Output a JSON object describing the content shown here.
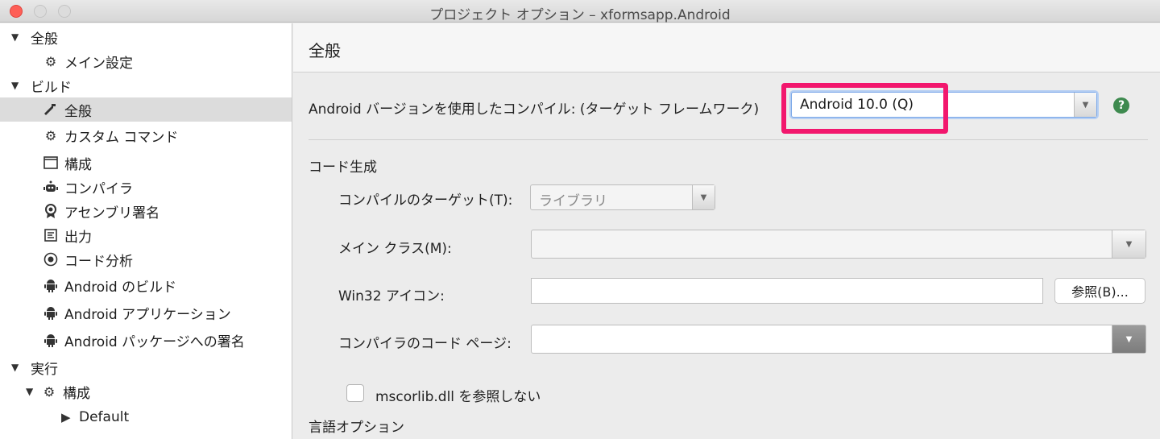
{
  "window": {
    "title": "プロジェクト オプション – xformsapp.Android"
  },
  "sidebar": {
    "items": [
      {
        "label": "全般",
        "icon": "triangle-down"
      },
      {
        "label": "メイン設定",
        "icon": "gear-icon"
      },
      {
        "label": "ビルド",
        "icon": "triangle-down"
      },
      {
        "label": "全般",
        "icon": "hammer-icon",
        "selected": true
      },
      {
        "label": "カスタム コマンド",
        "icon": "gear-icon"
      },
      {
        "label": "構成",
        "icon": "window-icon"
      },
      {
        "label": "コンパイラ",
        "icon": "robot-icon"
      },
      {
        "label": "アセンブリ署名",
        "icon": "badge-icon"
      },
      {
        "label": "出力",
        "icon": "output-icon"
      },
      {
        "label": "コード分析",
        "icon": "target-icon"
      },
      {
        "label": "Android のビルド",
        "icon": "android-icon"
      },
      {
        "label": "Android アプリケーション",
        "icon": "android-icon"
      },
      {
        "label": "Android パッケージへの署名",
        "icon": "android-icon"
      },
      {
        "label": "実行",
        "icon": "triangle-down"
      },
      {
        "label": "構成",
        "icon": "gear-icon"
      },
      {
        "label": "Default",
        "icon": "triangle-right"
      }
    ]
  },
  "main": {
    "header_title": "全般",
    "compile_label": "Android バージョンを使用したコンパイル: (ターゲット フレームワーク)",
    "compile_value": "Android 10.0 (Q)",
    "help_label": "?",
    "code_gen_title": "コード生成",
    "compile_target_label": "コンパイルのターゲット(T):",
    "compile_target_value": "ライブラリ",
    "main_class_label": "メイン クラス(M):",
    "main_class_value": "",
    "win32_icon_label": "Win32 アイコン:",
    "win32_icon_value": "",
    "browse_label": "参照(B)...",
    "codepage_label": "コンパイラのコード ページ:",
    "codepage_value": "",
    "mscorlib_label": "mscorlib.dll を参照しない",
    "mscorlib_checked": false,
    "lang_options_title": "言語オプション"
  },
  "colors": {
    "highlight": "#f2176d",
    "help": "#3e8a4f",
    "selection": "#dcdcdc"
  }
}
